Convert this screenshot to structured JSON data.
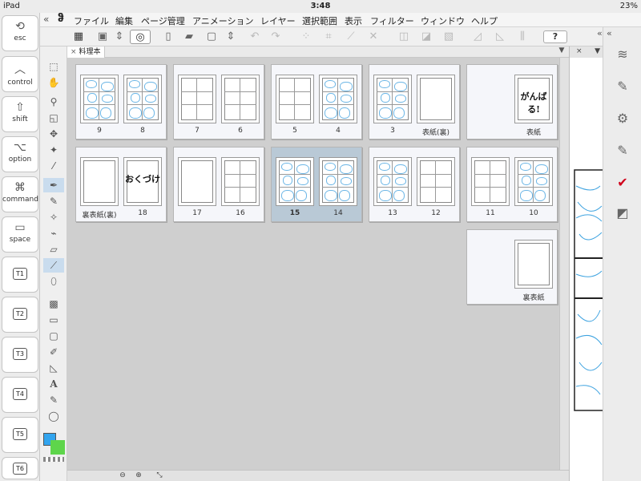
{
  "status": {
    "device": "iPad",
    "time": "3:48",
    "battery": "23%"
  },
  "keys": [
    {
      "glyph": "⟲",
      "label": "esc"
    },
    {
      "glyph": "︿",
      "label": "control"
    },
    {
      "glyph": "⇧",
      "label": "shift"
    },
    {
      "glyph": "⌥",
      "label": "option"
    },
    {
      "glyph": "⌘",
      "label": "command"
    },
    {
      "glyph": "▭",
      "label": "space"
    },
    {
      "label": "T1"
    },
    {
      "label": "T2"
    },
    {
      "label": "T3"
    },
    {
      "label": "T4"
    },
    {
      "label": "T5"
    },
    {
      "label": "T6"
    }
  ],
  "menu": {
    "collapse": "«",
    "logo": "ჵ",
    "items": [
      "ファイル",
      "編集",
      "ページ管理",
      "アニメーション",
      "レイヤー",
      "選択範囲",
      "表示",
      "フィルター",
      "ウィンドウ",
      "ヘルプ"
    ]
  },
  "toolbar": {
    "help_label": "?"
  },
  "tab": {
    "close": "×",
    "title": "料理本",
    "menu": "▼"
  },
  "nav_panel": {
    "close": "×",
    "menu": "▼"
  },
  "right_panel": {
    "collapse": "«",
    "expand": "«"
  },
  "colors": {
    "main": "#32a4ee",
    "sub": "#5ed54b",
    "accent": "#d0021b"
  },
  "spreads": [
    {
      "left": {
        "label": "9",
        "type": "sketch"
      },
      "right": {
        "label": "8",
        "type": "sketch"
      }
    },
    {
      "left": {
        "label": "7",
        "type": "panels"
      },
      "right": {
        "label": "6",
        "type": "panels"
      }
    },
    {
      "left": {
        "label": "5",
        "type": "panels"
      },
      "right": {
        "label": "4",
        "type": "sketch"
      }
    },
    {
      "left": {
        "label": "3",
        "type": "sketch"
      },
      "right": {
        "label": "表紙(裏)",
        "type": "blank"
      }
    },
    {
      "left": null,
      "right": {
        "label": "表紙",
        "type": "hand",
        "text": "がんばる!"
      }
    },
    {
      "left": {
        "label": "裏表紙(裏)",
        "type": "blank"
      },
      "right": {
        "label": "18",
        "type": "hand",
        "text": "おくづけ"
      }
    },
    {
      "left": {
        "label": "17",
        "type": "blank"
      },
      "right": {
        "label": "16",
        "type": "panels"
      }
    },
    {
      "left": {
        "label": "15",
        "type": "sketch"
      },
      "right": {
        "label": "14",
        "type": "sketch"
      },
      "selected": true
    },
    {
      "left": {
        "label": "13",
        "type": "sketch"
      },
      "right": {
        "label": "12",
        "type": "panels"
      }
    },
    {
      "left": {
        "label": "11",
        "type": "panels"
      },
      "right": {
        "label": "10",
        "type": "sketch"
      }
    },
    {
      "left": null,
      "right": {
        "label": "裏表紙",
        "type": "blank"
      }
    }
  ]
}
